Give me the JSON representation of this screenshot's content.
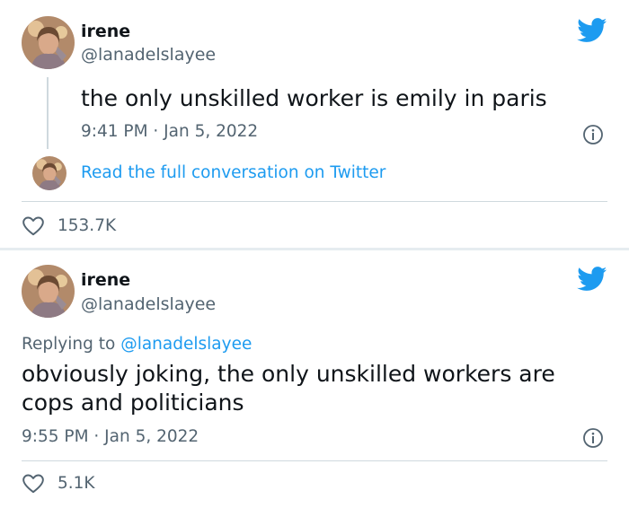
{
  "colors": {
    "twitter_blue": "#1d9bf0",
    "secondary_text": "#536471",
    "primary_text": "#0f1419",
    "divider": "#cfd9de"
  },
  "tweets": [
    {
      "author_name": "irene",
      "author_handle": "@lanadelslayee",
      "text": "the only unskilled worker is emily in paris",
      "timestamp": "9:41 PM · Jan 5, 2022",
      "read_more_label": "Read the full conversation on Twitter",
      "like_count": "153.7K",
      "icons": [
        "avatar",
        "twitter-bird-icon",
        "info-icon",
        "heart-icon"
      ]
    },
    {
      "author_name": "irene",
      "author_handle": "@lanadelslayee",
      "replying_prefix": "Replying to",
      "replying_to": "@lanadelslayee",
      "text_line1": "obviously joking, the only unskilled workers are",
      "text_line2": "cops and politicians",
      "timestamp": "9:55 PM · Jan 5, 2022",
      "like_count": "5.1K",
      "icons": [
        "avatar",
        "twitter-bird-icon",
        "info-icon",
        "heart-icon"
      ]
    }
  ]
}
